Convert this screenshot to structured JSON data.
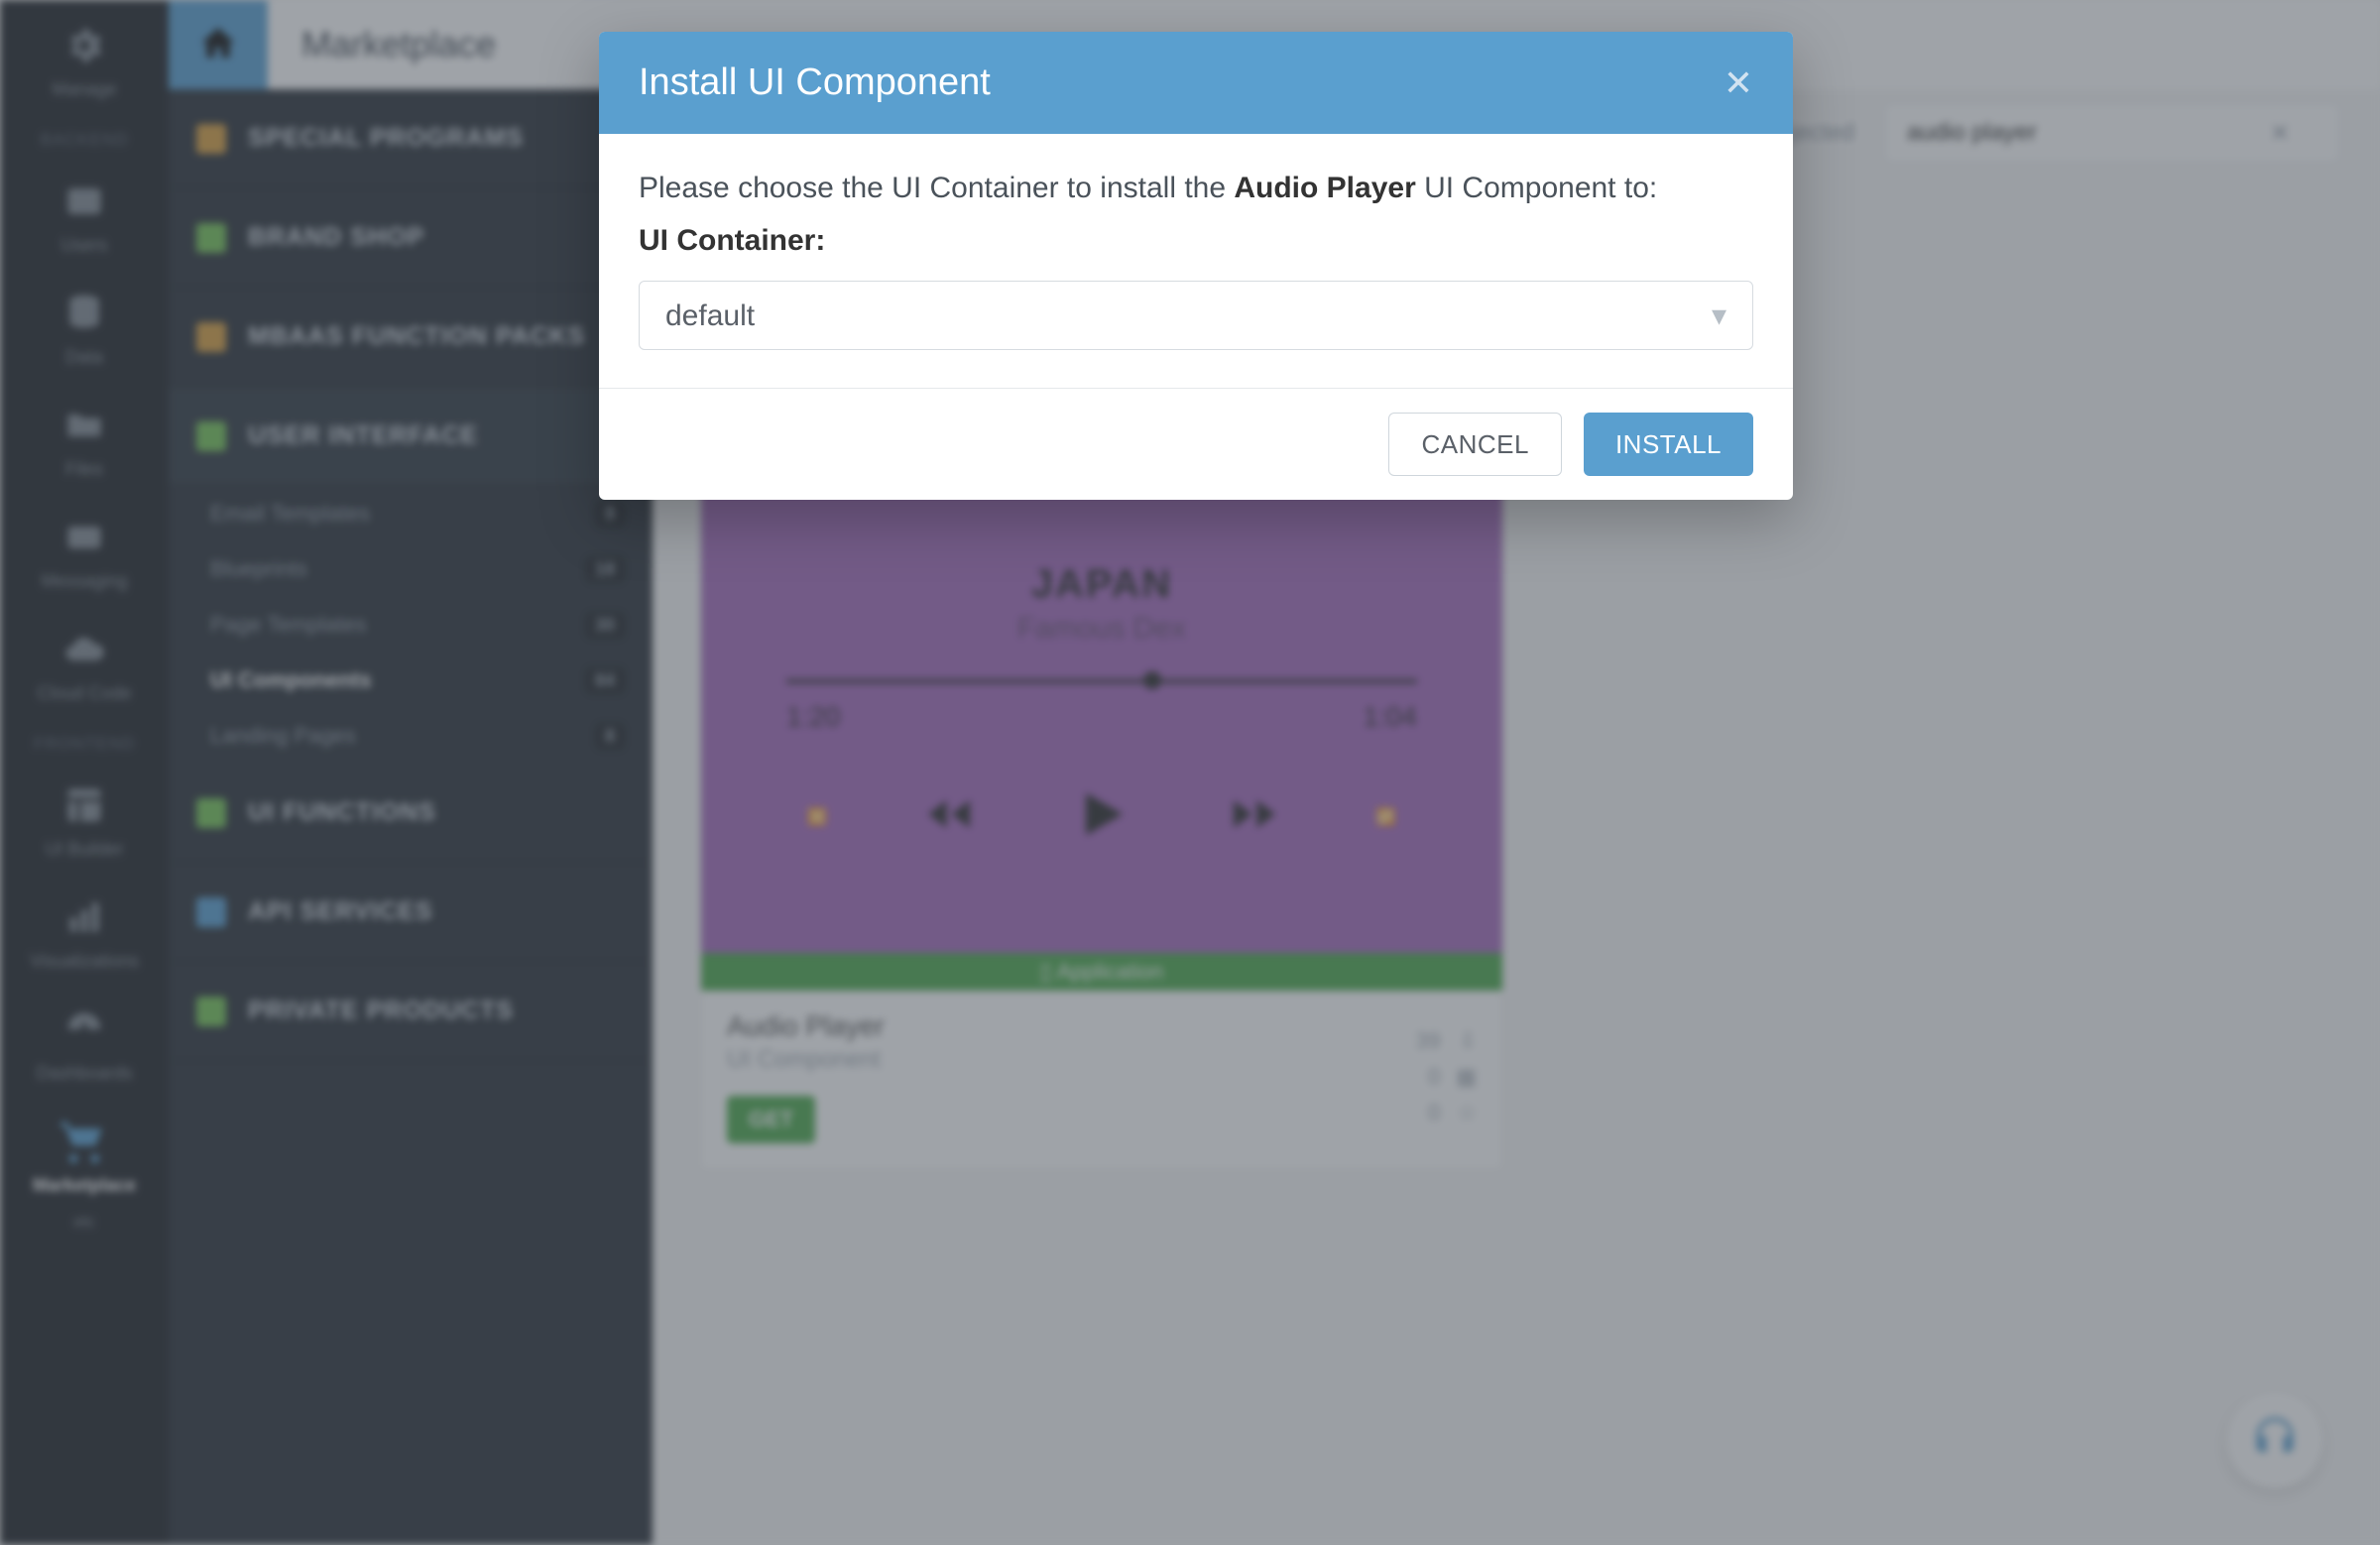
{
  "header": {
    "title": "Marketplace"
  },
  "rail": {
    "items": [
      {
        "label": "Manage"
      },
      {
        "section": "BACKEND"
      },
      {
        "label": "Users"
      },
      {
        "label": "Data"
      },
      {
        "label": "Files"
      },
      {
        "label": "Messaging"
      },
      {
        "label": "Cloud Code"
      },
      {
        "section": "FRONTEND"
      },
      {
        "label": "UI Builder"
      },
      {
        "label": "Visualizations"
      },
      {
        "label": "Dashboards"
      },
      {
        "label": "Marketplace"
      },
      {
        "label": "etc"
      }
    ]
  },
  "sidebar": {
    "items": [
      {
        "label": "SPECIAL PROGRAMS",
        "color": "#d79a32"
      },
      {
        "label": "BRAND SHOP",
        "color": "#6cc24a"
      },
      {
        "label": "MBAAS FUNCTION PACKS",
        "color": "#d79a32"
      },
      {
        "label": "USER INTERFACE",
        "color": "#6cc24a",
        "sub": [
          {
            "label": "Email Templates",
            "count": "9"
          },
          {
            "label": "Blueprints",
            "count": "18"
          },
          {
            "label": "Page Templates",
            "count": "30"
          },
          {
            "label": "UI Components",
            "count": "84",
            "active": true
          },
          {
            "label": "Landing Pages",
            "count": "8"
          }
        ]
      },
      {
        "label": "UI FUNCTIONS",
        "color": "#6cc24a"
      },
      {
        "label": "API SERVICES",
        "color": "#4c99cf"
      },
      {
        "label": "PRIVATE PRODUCTS",
        "color": "#6cc24a"
      }
    ]
  },
  "toolbar": {
    "status": "Rejected",
    "search_value": "audio player"
  },
  "product": {
    "name": "Audio Player",
    "type": "UI Component",
    "ribbon": "Application",
    "action": "GET",
    "track_title": "JAPAN",
    "track_artist": "Famous Dex",
    "time_elapsed": "1:20",
    "time_total": "1:04",
    "views_count": "39",
    "rating_count": "0",
    "downloads_count": "0"
  },
  "modal": {
    "title": "Install UI Component",
    "message_prefix": "Please choose the UI Container to install the ",
    "component_name": "Audio Player",
    "message_suffix": " UI Component to:",
    "select_label": "UI Container:",
    "select_value": "default",
    "cancel_label": "CANCEL",
    "install_label": "INSTALL"
  }
}
